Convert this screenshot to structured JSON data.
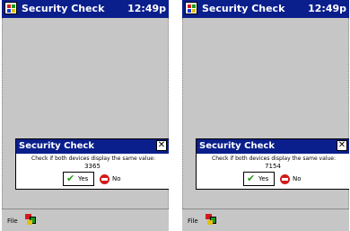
{
  "screens": [
    {
      "title": "Security Check",
      "clock": "12:49p",
      "dialog": {
        "title": "Security Check",
        "close_glyph": "✕",
        "message": "Check if both devices display the same value:",
        "code": "3365",
        "yes_label": "Yes",
        "no_label": "No"
      },
      "menu": {
        "file_label": "File"
      }
    },
    {
      "title": "Security Check",
      "clock": "12:49p",
      "dialog": {
        "title": "Security Check",
        "close_glyph": "✕",
        "message": "Check if both devices display the same value:",
        "code": "7154",
        "yes_label": "Yes",
        "no_label": "No"
      },
      "menu": {
        "file_label": "File"
      }
    }
  ],
  "icons": {
    "start": "windows-start-icon",
    "check": "checkmark-icon",
    "stop": "stop-sign-icon",
    "sip": "input-panel-icon"
  },
  "colors": {
    "titlebar": "#0a1f8c",
    "background": "#c6c6c6"
  }
}
